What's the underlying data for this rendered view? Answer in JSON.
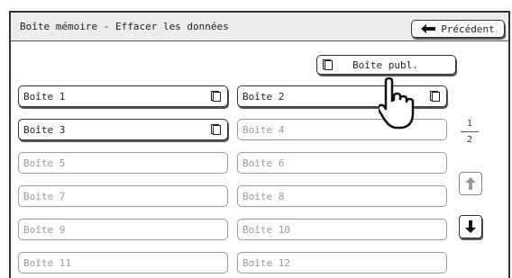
{
  "header": {
    "title": "Boîte mémoire - Effacer les données",
    "back_label": "Précédent"
  },
  "public_box": {
    "label": "Boîte publ."
  },
  "boxes": [
    {
      "label": "Boîte 1",
      "state": "active",
      "has_doc": true
    },
    {
      "label": "Boîte 2",
      "state": "active",
      "has_doc": true
    },
    {
      "label": "Boîte 3",
      "state": "active",
      "has_doc": true
    },
    {
      "label": "Boîte 4",
      "state": "inactive",
      "has_doc": false
    },
    {
      "label": "Boîte 5",
      "state": "inactive",
      "has_doc": false
    },
    {
      "label": "Boîte 6",
      "state": "inactive",
      "has_doc": false
    },
    {
      "label": "Boîte 7",
      "state": "inactive",
      "has_doc": false
    },
    {
      "label": "Boîte 8",
      "state": "inactive",
      "has_doc": false
    },
    {
      "label": "Boîte 9",
      "state": "inactive",
      "has_doc": false
    },
    {
      "label": "Boîte 10",
      "state": "inactive",
      "has_doc": false
    },
    {
      "label": "Boîte 11",
      "state": "inactive",
      "has_doc": false
    },
    {
      "label": "Boîte 12",
      "state": "inactive",
      "has_doc": false
    }
  ],
  "pagination": {
    "current": "1",
    "total": "2"
  },
  "icons": {
    "back": "arrow-left-icon",
    "document": "document-icon",
    "up": "arrow-up-icon",
    "down": "arrow-down-icon",
    "pointer": "hand-pointer-icon"
  },
  "colors": {
    "active_border": "#333333",
    "inactive_text": "#9a9a9a",
    "title_bar": "#ececec"
  }
}
